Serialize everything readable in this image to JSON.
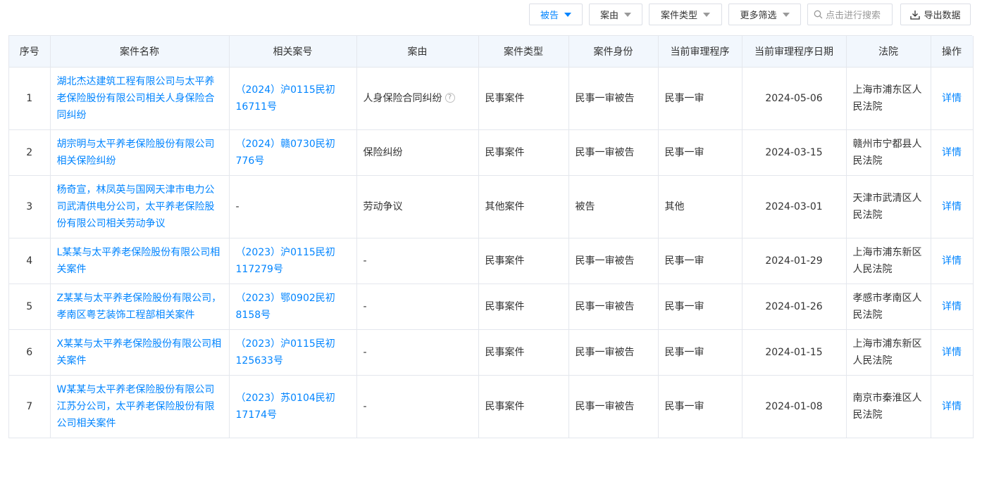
{
  "toolbar": {
    "defendant_filter": "被告",
    "cause_filter": "案由",
    "case_type_filter": "案件类型",
    "more_filter": "更多筛选",
    "search_placeholder": "点击进行搜索",
    "export_label": "导出数据",
    "accent_color": "#0084ff"
  },
  "table": {
    "headers": [
      "序号",
      "案件名称",
      "相关案号",
      "案由",
      "案件类型",
      "案件身份",
      "当前审理程序",
      "当前审理程序日期",
      "法院",
      "操作"
    ],
    "rows": [
      {
        "no": "1",
        "name": "湖北杰达建筑工程有限公司与太平养老保险股份有限公司相关人身保险合同纠纷",
        "case_no": "（2024）沪0115民初16711号",
        "cause": "人身保险合同纠纷",
        "cause_help": "?",
        "type": "民事案件",
        "identity": "民事一审被告",
        "procedure": "民事一审",
        "date": "2024-05-06",
        "court": "上海市浦东区人民法院",
        "action": "详情"
      },
      {
        "no": "2",
        "name": "胡宗明与太平养老保险股份有限公司相关保险纠纷",
        "case_no": "（2024）赣0730民初776号",
        "cause": "保险纠纷",
        "type": "民事案件",
        "identity": "民事一审被告",
        "procedure": "民事一审",
        "date": "2024-03-15",
        "court": "赣州市宁都县人民法院",
        "action": "详情"
      },
      {
        "no": "3",
        "name": "杨奇宣，林凤英与国网天津市电力公司武清供电分公司，太平养老保险股份有限公司相关劳动争议",
        "case_no": "-",
        "cause": "劳动争议",
        "type": "其他案件",
        "identity": "被告",
        "procedure": "其他",
        "date": "2024-03-01",
        "court": "天津市武清区人民法院",
        "action": "详情"
      },
      {
        "no": "4",
        "name": "L某某与太平养老保险股份有限公司相关案件",
        "case_no": "（2023）沪0115民初117279号",
        "cause": "-",
        "type": "民事案件",
        "identity": "民事一审被告",
        "procedure": "民事一审",
        "date": "2024-01-29",
        "court": "上海市浦东新区人民法院",
        "action": "详情"
      },
      {
        "no": "5",
        "name": "Z某某与太平养老保险股份有限公司，孝南区粤艺装饰工程部相关案件",
        "case_no": "（2023）鄂0902民初8158号",
        "cause": "-",
        "type": "民事案件",
        "identity": "民事一审被告",
        "procedure": "民事一审",
        "date": "2024-01-26",
        "court": "孝感市孝南区人民法院",
        "action": "详情"
      },
      {
        "no": "6",
        "name": "X某某与太平养老保险股份有限公司相关案件",
        "case_no": "（2023）沪0115民初125633号",
        "cause": "-",
        "type": "民事案件",
        "identity": "民事一审被告",
        "procedure": "民事一审",
        "date": "2024-01-15",
        "court": "上海市浦东新区人民法院",
        "action": "详情"
      },
      {
        "no": "7",
        "name": "W某某与太平养老保险股份有限公司江苏分公司，太平养老保险股份有限公司相关案件",
        "case_no": "（2023）苏0104民初17174号",
        "cause": "-",
        "type": "民事案件",
        "identity": "民事一审被告",
        "procedure": "民事一审",
        "date": "2024-01-08",
        "court": "南京市秦淮区人民法院",
        "action": "详情"
      }
    ]
  }
}
